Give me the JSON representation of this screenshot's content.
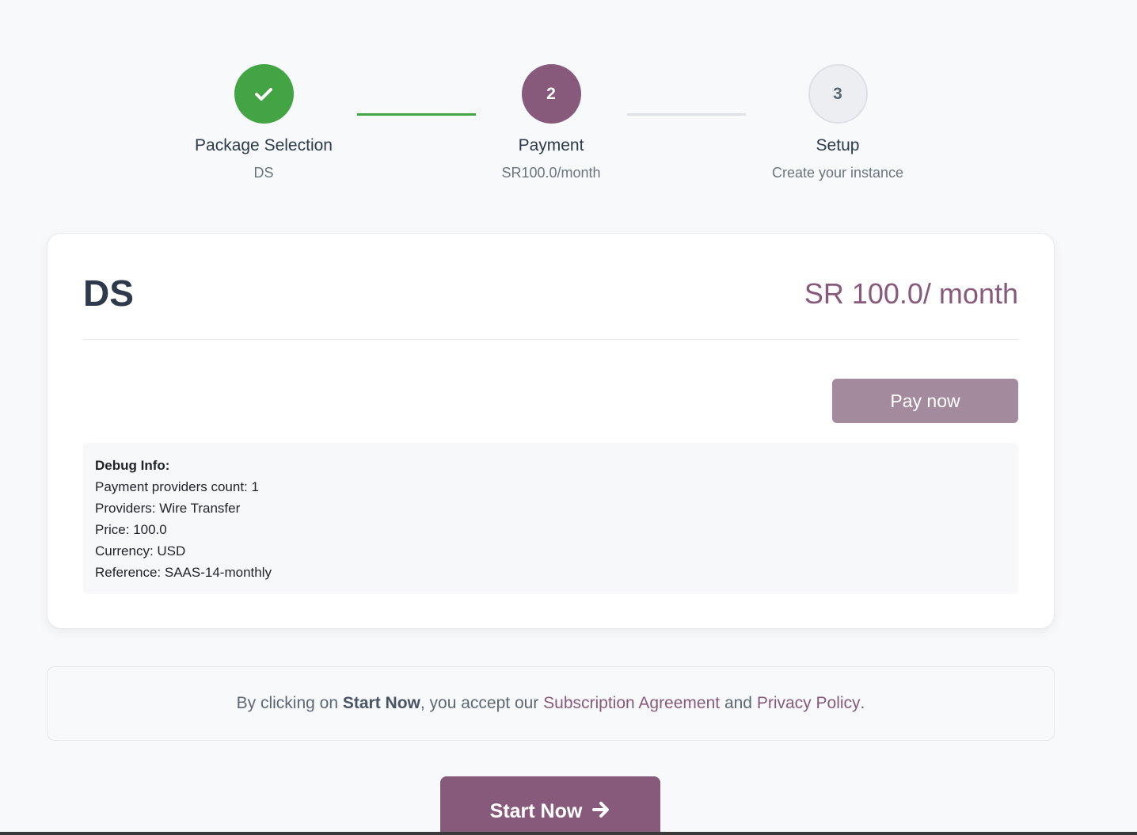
{
  "stepper": {
    "steps": [
      {
        "number": "",
        "title": "Package Selection",
        "subtitle": "DS",
        "state": "done"
      },
      {
        "number": "2",
        "title": "Payment",
        "subtitle": "SR100.0/month",
        "state": "active"
      },
      {
        "number": "3",
        "title": "Setup",
        "subtitle": "Create your instance",
        "state": "pending"
      }
    ]
  },
  "plan": {
    "name": "DS",
    "price": "SR 100.0/ month"
  },
  "payment": {
    "pay_label": "Pay now"
  },
  "debug": {
    "title": "Debug Info:",
    "lines": [
      "Payment providers count: 1",
      "Providers: Wire Transfer",
      "Price: 100.0",
      "Currency: USD",
      "Reference: SAAS-14-monthly"
    ]
  },
  "terms": {
    "prefix": "By clicking on ",
    "cta_name": "Start Now",
    "middle": ", you accept our ",
    "agreement_link": "Subscription Agreement",
    "and": " and ",
    "privacy_link": "Privacy Policy",
    "suffix": "."
  },
  "start": {
    "label": "Start Now"
  },
  "colors": {
    "accent": "#875a7b",
    "success": "#43a443",
    "pay_button": "#a48a9d"
  }
}
